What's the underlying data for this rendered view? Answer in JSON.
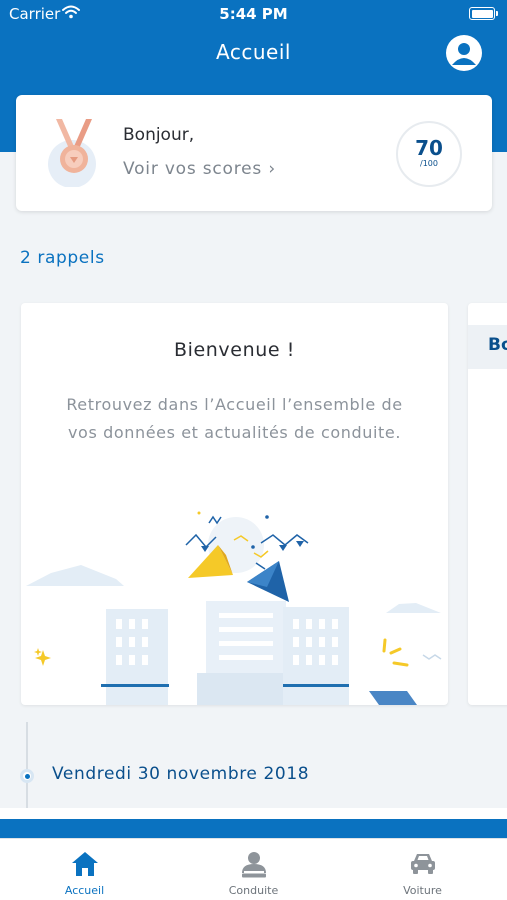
{
  "colors": {
    "accent": "#0a72c0",
    "dark_blue": "#0a4f8c",
    "inactive": "#8e949a"
  },
  "status_bar": {
    "carrier": "Carrier",
    "time": "5:44 PM"
  },
  "header": {
    "title": "Accueil",
    "profile_icon": "profile-icon"
  },
  "score_card": {
    "greeting": "Bonjour,",
    "link_label": "Voir vos scores",
    "score": "70",
    "score_max": "/100",
    "medal_icon": "medal-icon"
  },
  "reminders": {
    "label": "2 rappels"
  },
  "welcome_card": {
    "title": "Bienvenue !",
    "text": "Retrouvez dans l’Accueil l’ensemble de vos données et actualités de conduite."
  },
  "next_card": {
    "title_fragment": "Bo"
  },
  "timeline": {
    "date": "Vendredi 30 novembre 2018"
  },
  "tabs": [
    {
      "label": "Accueil",
      "icon": "home-icon",
      "active": true
    },
    {
      "label": "Conduite",
      "icon": "driver-icon",
      "active": false
    },
    {
      "label": "Voiture",
      "icon": "car-icon",
      "active": false
    }
  ]
}
